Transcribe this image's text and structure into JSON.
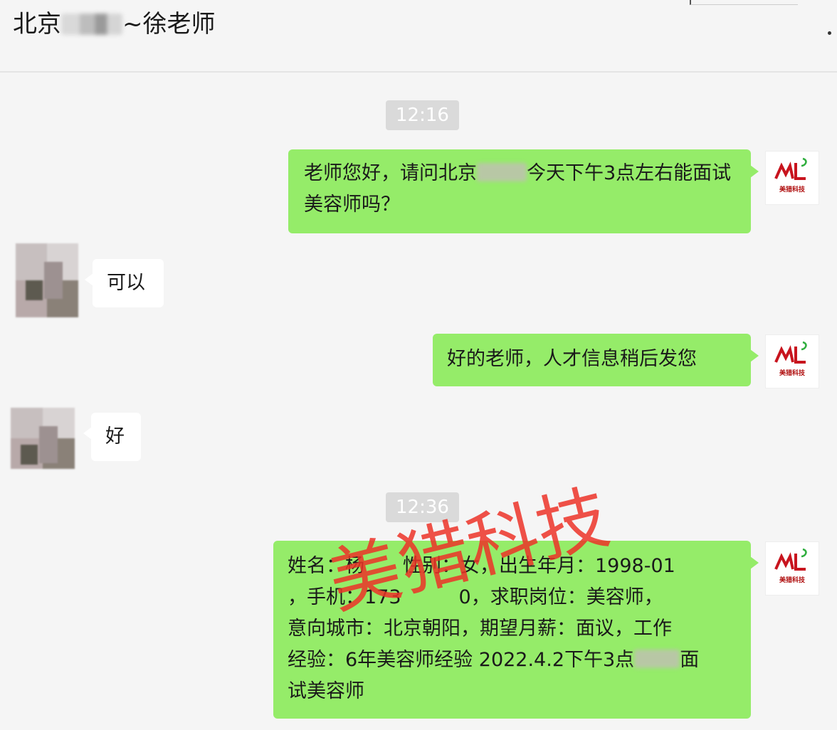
{
  "header": {
    "title_prefix": "北京",
    "title_suffix": "~徐老师"
  },
  "messages": {
    "time_1": "12:16",
    "time_2": "12:36",
    "m1_part1": "老师您好，请问北京",
    "m1_part2": "今天下午3点左右能面试美容师吗？",
    "m2": "可以",
    "m3": "好的老师，人才信息稍后发您",
    "m4": "好",
    "m5_line1": "姓名：杨　　性别：女，出生年月：1998-01",
    "m5_line2": "，手机：173　　　0，求职岗位：美容师，",
    "m5_line3": "意向城市：北京朝阳，期望月薪：面议，工作",
    "m5_line4_a": "经验：6年美容师经验 2022.4.2下午3点",
    "m5_line4_b": "面",
    "m5_line5": "试美容师"
  },
  "avatar": {
    "logo_text": "ML",
    "logo_sub": "美猎科技"
  },
  "watermark": "美猎科技",
  "colors": {
    "my_bubble": "#95ec69",
    "their_bubble": "#ffffff",
    "background": "#f5f5f5",
    "watermark": "#ec3228"
  }
}
